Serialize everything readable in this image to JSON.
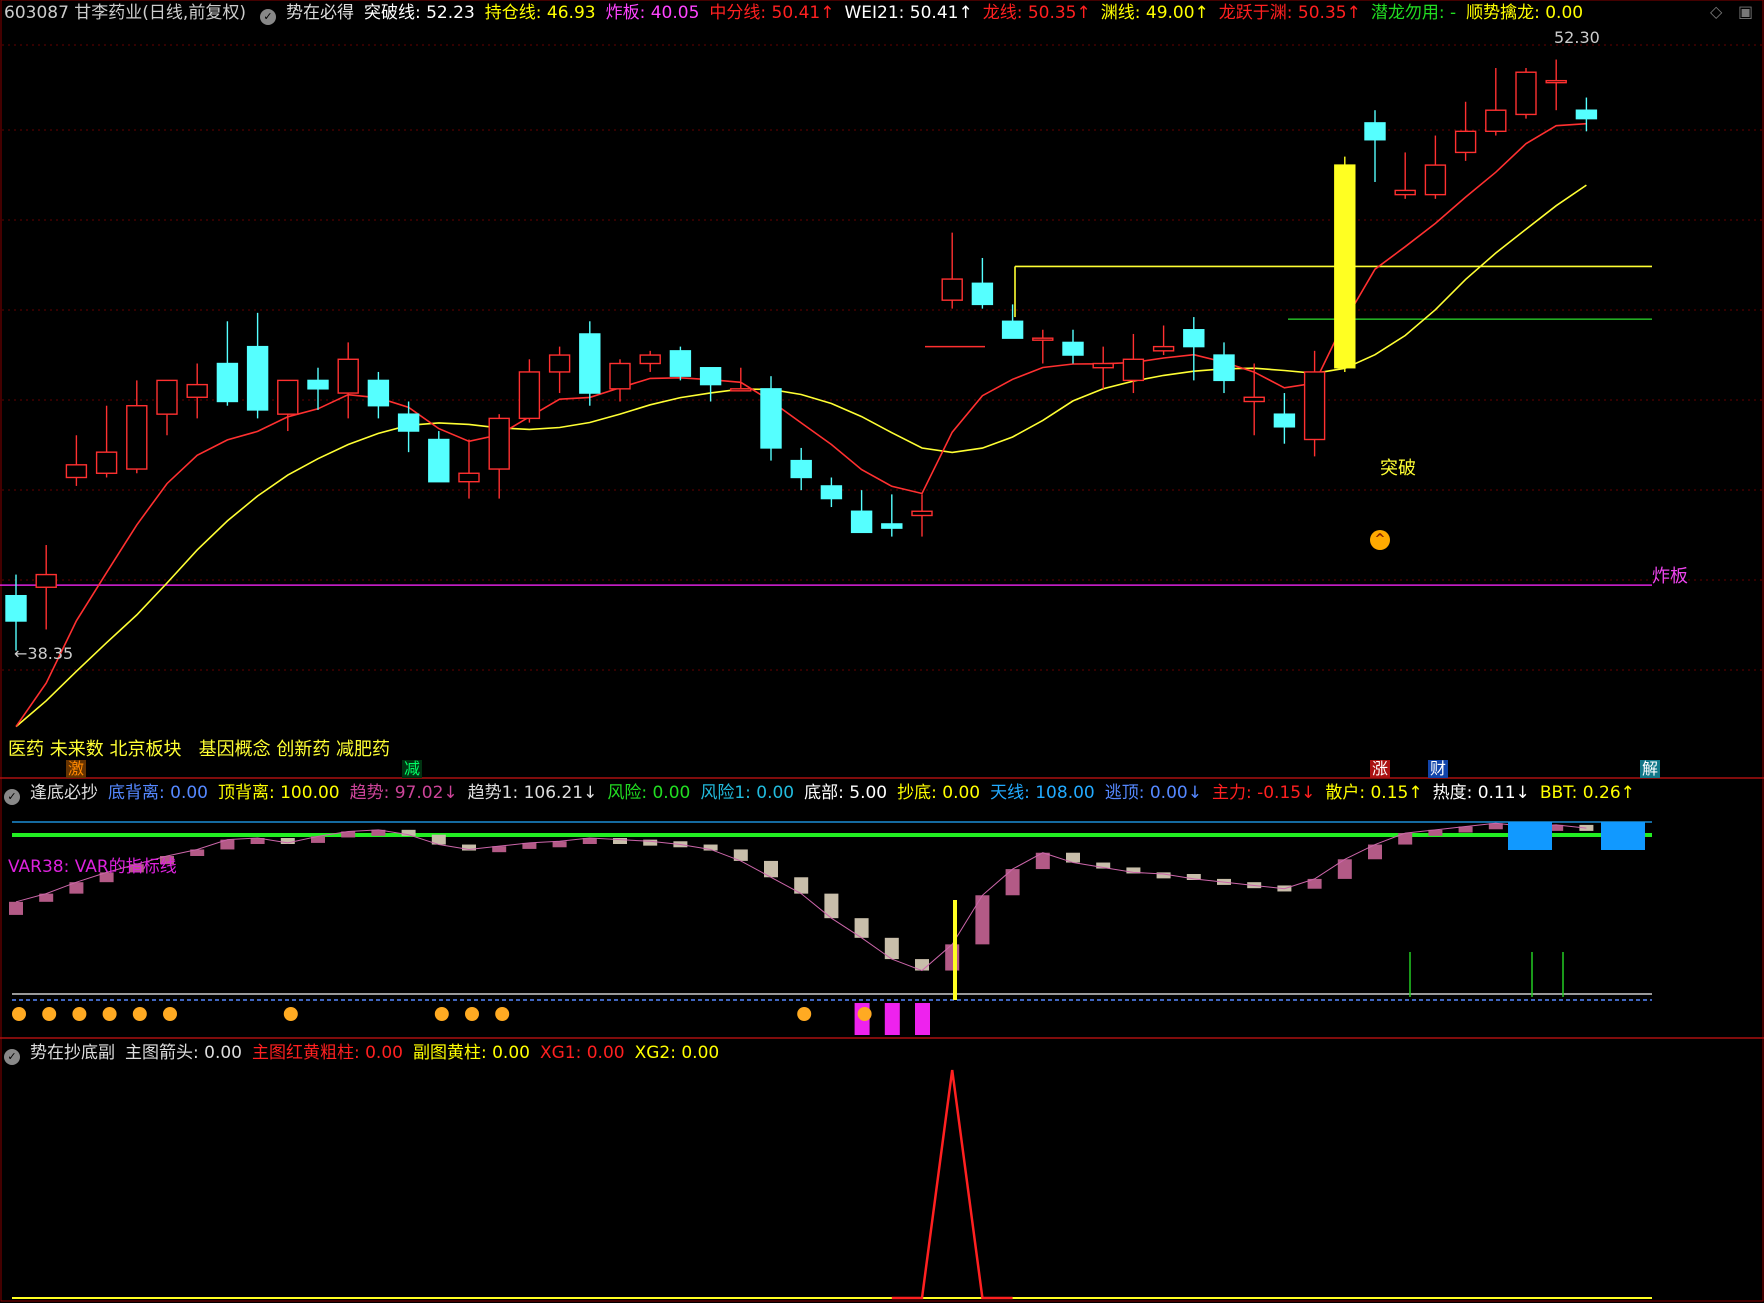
{
  "header": {
    "stock": "603087 甘李药业(日线,前复权)",
    "indicator": "势在必得",
    "items": [
      {
        "label": "突破线: 52.23",
        "color": "#ffffff"
      },
      {
        "label": "持仓线: 46.93",
        "color": "#ffff00"
      },
      {
        "label": "炸板: 40.05",
        "color": "#ff44ff"
      },
      {
        "label": "中分线: 50.41↑",
        "color": "#ff2020"
      },
      {
        "label": "WEI21: 50.41↑",
        "color": "#ffffff"
      },
      {
        "label": "龙线: 50.35↑",
        "color": "#ff2020"
      },
      {
        "label": "渊线: 49.00↑",
        "color": "#ffff00"
      },
      {
        "label": "龙跃于渊: 50.35↑",
        "color": "#ff2020"
      },
      {
        "label": "潜龙勿用: -",
        "color": "#22dd22"
      },
      {
        "label": "顺势擒龙: 0.00",
        "color": "#ffff00"
      }
    ]
  },
  "main_labels": {
    "high": "52.30",
    "low": "←38.35",
    "tupo": "突破",
    "zhaban": "炸板",
    "sectors": "医药 未来数 北京板块   基因概念 创新药 减肥药",
    "tags": [
      {
        "text": "激",
        "color": "#ff8800",
        "bg": "#663300"
      },
      {
        "text": "减",
        "color": "#00ff66",
        "bg": "#003311"
      },
      {
        "text": "涨",
        "color": "#ffffff",
        "bg": "#aa1111"
      },
      {
        "text": "财",
        "color": "#ffffff",
        "bg": "#1144aa"
      },
      {
        "text": "解",
        "color": "#ffffff",
        "bg": "#117788"
      }
    ]
  },
  "panel2_header": {
    "name": "逢底必抄",
    "items": [
      {
        "label": "底背离: 0.00",
        "color": "#5588ff"
      },
      {
        "label": "顶背离: 100.00",
        "color": "#ffff00"
      },
      {
        "label": "趋势: 97.02↓",
        "color": "#cc4499"
      },
      {
        "label": "趋势1: 106.21↓",
        "color": "#dddddd"
      },
      {
        "label": "风险: 0.00",
        "color": "#22dd22"
      },
      {
        "label": "风险1: 0.00",
        "color": "#22bbdd"
      },
      {
        "label": "底部: 5.00",
        "color": "#ffffff"
      },
      {
        "label": "抄底: 0.00",
        "color": "#ffff00"
      },
      {
        "label": "天线: 108.00",
        "color": "#22aaff"
      },
      {
        "label": "逃顶: 0.00↓",
        "color": "#5588ff"
      },
      {
        "label": "主力: -0.15↓",
        "color": "#ff2020"
      },
      {
        "label": "散户: 0.15↑",
        "color": "#ffff00"
      },
      {
        "label": "热度: 0.11↓",
        "color": "#ffffff"
      },
      {
        "label": "BBT: 0.26↑",
        "color": "#ffff00"
      }
    ],
    "var_label": "VAR38: VAR的指标线"
  },
  "panel3_header": {
    "name": "势在抄底副",
    "items": [
      {
        "label": "主图箭头: 0.00",
        "color": "#dddddd"
      },
      {
        "label": "主图红黄粗柱: 0.00",
        "color": "#ff2020"
      },
      {
        "label": "副图黄柱: 0.00",
        "color": "#ffff00"
      },
      {
        "label": "XG1: 0.00",
        "color": "#ff2020"
      },
      {
        "label": "XG2: 0.00",
        "color": "#ffff00"
      }
    ]
  },
  "colors": {
    "up": "#ff3030",
    "down": "#55ffff",
    "panel_border": "#aa1111"
  },
  "chart_data": [
    {
      "type": "candlestick",
      "title": "603087 甘李药业(日线,前复权)",
      "ylim": [
        36.5,
        53.2
      ],
      "candles": [
        [
          39.8,
          39.2,
          40.3,
          38.5
        ],
        [
          40.0,
          40.3,
          41.0,
          39.0
        ],
        [
          42.6,
          42.9,
          43.6,
          42.4
        ],
        [
          42.7,
          43.2,
          44.3,
          42.6
        ],
        [
          42.8,
          44.3,
          44.9,
          42.7
        ],
        [
          44.1,
          44.9,
          44.9,
          43.6
        ],
        [
          44.5,
          44.8,
          45.3,
          44.0
        ],
        [
          45.3,
          44.4,
          46.3,
          44.3
        ],
        [
          45.7,
          44.2,
          46.5,
          44.0
        ],
        [
          44.1,
          44.9,
          44.9,
          43.7
        ],
        [
          44.9,
          44.7,
          45.2,
          44.2
        ],
        [
          44.6,
          45.4,
          45.8,
          44.0
        ],
        [
          44.9,
          44.3,
          45.1,
          44.0
        ],
        [
          44.1,
          43.7,
          44.4,
          43.2
        ],
        [
          43.5,
          42.5,
          43.7,
          42.5
        ],
        [
          42.5,
          42.7,
          43.5,
          42.1
        ],
        [
          42.8,
          44.0,
          44.1,
          42.1
        ],
        [
          44.0,
          45.1,
          45.4,
          43.9
        ],
        [
          45.1,
          45.5,
          45.7,
          44.6
        ],
        [
          46.0,
          44.6,
          46.3,
          44.3
        ],
        [
          44.7,
          45.3,
          45.4,
          44.4
        ],
        [
          45.3,
          45.5,
          45.6,
          45.1
        ],
        [
          45.6,
          45.0,
          45.7,
          44.9
        ],
        [
          45.2,
          44.8,
          45.2,
          44.4
        ],
        [
          44.7,
          44.7,
          45.2,
          44.7
        ],
        [
          44.7,
          43.3,
          45.0,
          43.0
        ],
        [
          43.0,
          42.6,
          43.3,
          42.3
        ],
        [
          42.4,
          42.1,
          42.6,
          41.9
        ],
        [
          41.8,
          41.3,
          42.3,
          41.3
        ],
        [
          41.5,
          41.4,
          42.2,
          41.2
        ],
        [
          41.7,
          41.8,
          42.2,
          41.2
        ],
        [
          46.8,
          47.3,
          48.4,
          46.6
        ],
        [
          47.2,
          46.7,
          47.8,
          46.6
        ],
        [
          46.3,
          45.9,
          46.7,
          45.9
        ],
        [
          45.9,
          45.9,
          46.1,
          45.3
        ],
        [
          45.8,
          45.5,
          46.1,
          45.3
        ],
        [
          45.2,
          45.3,
          45.7,
          44.7
        ],
        [
          44.9,
          45.4,
          46.0,
          44.6
        ],
        [
          45.6,
          45.7,
          46.2,
          45.5
        ],
        [
          46.1,
          45.7,
          46.4,
          44.9
        ],
        [
          45.5,
          44.9,
          45.8,
          44.6
        ],
        [
          44.4,
          44.5,
          45.3,
          43.6
        ],
        [
          44.1,
          43.8,
          44.6,
          43.4
        ],
        [
          43.5,
          45.1,
          45.6,
          43.1
        ],
        [
          45.2,
          50.0,
          50.2,
          45.1
        ],
        [
          51.0,
          50.6,
          51.3,
          49.6
        ],
        [
          49.3,
          49.4,
          50.3,
          49.2
        ],
        [
          49.3,
          50.0,
          50.7,
          49.2
        ],
        [
          50.3,
          50.8,
          51.5,
          50.1
        ],
        [
          50.8,
          51.3,
          52.3,
          50.7
        ],
        [
          51.2,
          52.2,
          52.3,
          51.1
        ],
        [
          52.0,
          52.0,
          52.5,
          51.3
        ],
        [
          51.3,
          51.1,
          51.6,
          50.8
        ]
      ],
      "lines": [
        {
          "name": "中分线",
          "color": "#ff3030"
        },
        {
          "name": "渊线",
          "color": "#ffff00"
        }
      ],
      "hlines": [
        {
          "name": "炸板",
          "value": 40.05,
          "color": "#dd22dd"
        },
        {
          "name": "突破线",
          "value": 47.6,
          "color": "#ffff33"
        },
        {
          "name": "持仓线",
          "value": 46.35,
          "color": "#22aa22"
        }
      ]
    },
    {
      "type": "bar",
      "title": "逢底必抄",
      "ylim": [
        0,
        110
      ],
      "values": [
        60,
        65,
        72,
        78,
        83,
        88,
        92,
        98,
        99,
        96,
        100,
        103,
        104,
        101,
        95,
        92,
        94,
        96,
        97,
        99,
        98,
        97,
        95,
        92,
        85,
        75,
        65,
        50,
        38,
        25,
        18,
        34,
        64,
        80,
        90,
        84,
        81,
        78,
        77,
        74,
        72,
        70,
        68,
        74,
        86,
        95,
        102,
        104,
        106,
        108,
        106,
        107,
        105
      ]
    },
    {
      "type": "line",
      "title": "势在抄底副",
      "ylim": [
        0,
        1
      ],
      "values": [
        0,
        0,
        0,
        0,
        0,
        0,
        0,
        0,
        0,
        0,
        0,
        0,
        0,
        0,
        0,
        0,
        0,
        0,
        0,
        0,
        0,
        0,
        0,
        0,
        0,
        0,
        0,
        0,
        0,
        0,
        0,
        1,
        0,
        0,
        0,
        0,
        0,
        0,
        0,
        0,
        0,
        0,
        0,
        0,
        0,
        0,
        0,
        0,
        0,
        0,
        0,
        0,
        0
      ]
    }
  ]
}
